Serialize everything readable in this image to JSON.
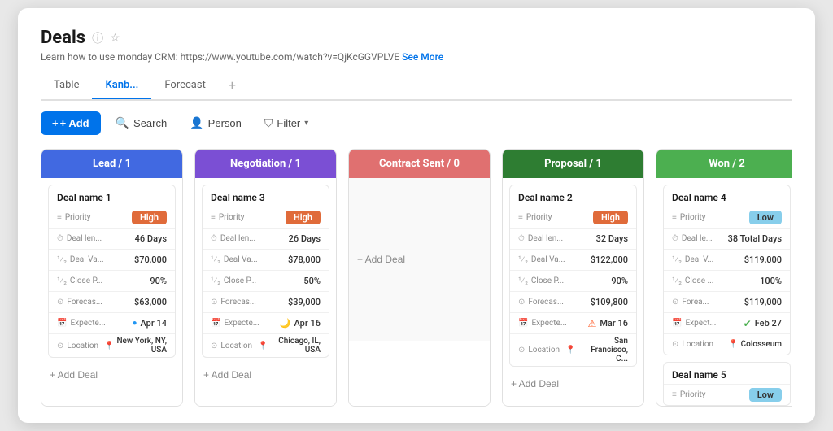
{
  "page": {
    "title": "Deals",
    "subtitle_text": "Learn how to use monday CRM: https://www.youtube.com/watch?v=QjKcGGVPLVE",
    "subtitle_link": "See More",
    "tabs": [
      "Table",
      "Kanb...",
      "Forecast"
    ],
    "active_tab": "Kanb...",
    "toolbar": {
      "add_label": "+ Add",
      "search_label": "Search",
      "person_label": "Person",
      "filter_label": "Filter"
    }
  },
  "columns": [
    {
      "id": "lead",
      "header": "Lead / 1",
      "style": "lead",
      "deals": [
        {
          "title": "Deal name 1",
          "rows": [
            {
              "icon": "≡",
              "label": "Priority",
              "value": "High",
              "type": "badge-high"
            },
            {
              "icon": "⏱",
              "label": "Deal len...",
              "value": "46 Days",
              "type": "text"
            },
            {
              "icon": "¹⁄₂",
              "label": "Deal Va...",
              "value": "$70,000",
              "type": "text"
            },
            {
              "icon": "¹⁄₂",
              "label": "Close P...",
              "value": "90%",
              "type": "text"
            },
            {
              "icon": "⊙",
              "label": "Forecas...",
              "value": "$63,000",
              "type": "text"
            },
            {
              "icon": "📅",
              "label": "Expecte...",
              "value": "Apr 14",
              "type": "date-blue"
            },
            {
              "icon": "⊙",
              "label": "Location",
              "value": "New York, NY, USA",
              "type": "location"
            }
          ]
        }
      ]
    },
    {
      "id": "negotiation",
      "header": "Negotiation / 1",
      "style": "negotiation",
      "deals": [
        {
          "title": "Deal name 3",
          "rows": [
            {
              "icon": "≡",
              "label": "Priority",
              "value": "High",
              "type": "badge-high"
            },
            {
              "icon": "⏱",
              "label": "Deal len...",
              "value": "26 Days",
              "type": "text"
            },
            {
              "icon": "¹⁄₂",
              "label": "Deal Va...",
              "value": "$78,000",
              "type": "text"
            },
            {
              "icon": "¹⁄₂",
              "label": "Close P...",
              "value": "50%",
              "type": "text"
            },
            {
              "icon": "⊙",
              "label": "Forecas...",
              "value": "$39,000",
              "type": "text"
            },
            {
              "icon": "📅",
              "label": "Expecte...",
              "value": "Apr 16",
              "type": "date-moon"
            },
            {
              "icon": "⊙",
              "label": "Location",
              "value": "Chicago, IL, USA",
              "type": "location"
            }
          ]
        }
      ]
    },
    {
      "id": "contract",
      "header": "Contract Sent / 0",
      "style": "contract",
      "deals": [],
      "empty": true
    },
    {
      "id": "proposal",
      "header": "Proposal / 1",
      "style": "proposal",
      "deals": [
        {
          "title": "Deal name 2",
          "rows": [
            {
              "icon": "≡",
              "label": "Priority",
              "value": "High",
              "type": "badge-high"
            },
            {
              "icon": "⏱",
              "label": "Deal len...",
              "value": "32 Days",
              "type": "text"
            },
            {
              "icon": "¹⁄₂",
              "label": "Deal Va...",
              "value": "$122,000",
              "type": "text"
            },
            {
              "icon": "¹⁄₂",
              "label": "Close P...",
              "value": "90%",
              "type": "text"
            },
            {
              "icon": "⊙",
              "label": "Forecas...",
              "value": "$109,800",
              "type": "text"
            },
            {
              "icon": "📅",
              "label": "Expecte...",
              "value": "Mar 16",
              "type": "date-orange"
            },
            {
              "icon": "⊙",
              "label": "Location",
              "value": "San Francisco, C...",
              "type": "location"
            }
          ]
        }
      ]
    },
    {
      "id": "won",
      "header": "Won / 2",
      "style": "won",
      "deals": [
        {
          "title": "Deal name 4",
          "rows": [
            {
              "icon": "≡",
              "label": "Priority",
              "value": "Low",
              "type": "badge-low"
            },
            {
              "icon": "⏱",
              "label": "Deal le...",
              "value": "38 Total Days",
              "type": "text"
            },
            {
              "icon": "¹⁄₂",
              "label": "Deal V...",
              "value": "$119,000",
              "type": "text"
            },
            {
              "icon": "¹⁄₂",
              "label": "Close ...",
              "value": "100%",
              "type": "text"
            },
            {
              "icon": "⊙",
              "label": "Forea...",
              "value": "$119,000",
              "type": "text"
            },
            {
              "icon": "📅",
              "label": "Expect...",
              "value": "Feb 27",
              "type": "date-green"
            },
            {
              "icon": "⊙",
              "label": "Location",
              "value": "Colosseum",
              "type": "location"
            }
          ]
        },
        {
          "title": "Deal name 5",
          "rows": [
            {
              "icon": "≡",
              "label": "Priority",
              "value": "Low",
              "type": "badge-low"
            }
          ],
          "partial": true
        }
      ]
    }
  ]
}
